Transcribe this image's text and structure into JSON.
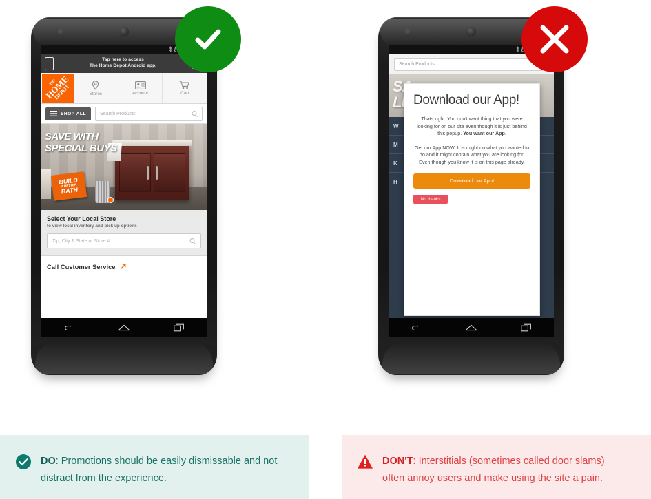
{
  "left": {
    "badge": {
      "icon": "check-circle-icon",
      "color": "#0f8c14"
    },
    "phone": {
      "status_bar": {
        "icons": [
          "bluetooth-icon",
          "nfc-icon",
          "wifi-icon",
          "signal-icon",
          "battery-icon"
        ]
      },
      "app_banner": {
        "icon": "mobile-phone-icon",
        "line1": "Tap here to access",
        "line2": "The Home Depot Android app.",
        "close_label": "✕"
      },
      "header": {
        "logo": {
          "the": "THE",
          "home": "HOME",
          "depot": "DEPOT"
        },
        "nav": [
          {
            "label": "Stores",
            "icon": "map-pin-icon"
          },
          {
            "label": "Account",
            "icon": "account-card-icon"
          },
          {
            "label": "Cart",
            "icon": "shopping-cart-icon"
          }
        ]
      },
      "search_row": {
        "shop_all_label": "SHOP ALL",
        "menu_icon": "hamburger-icon",
        "search_placeholder": "Search Products",
        "search_icon": "search-icon"
      },
      "hero": {
        "title_line1": "SAVE WITH",
        "title_line2": "SPECIAL BUYS",
        "badge_line1": "BUILD",
        "badge_line2": "A BETTER",
        "badge_line3": "BATH"
      },
      "local_store": {
        "title": "Select Your Local Store",
        "subtitle": "to view local inventory and pick up options",
        "input_placeholder": "Zip, City & State or Store #",
        "search_icon": "search-icon"
      },
      "call_row": {
        "label": "Call Customer Service",
        "icon": "external-link-arrow-icon"
      },
      "nav_bar": {
        "icons": [
          "back-icon",
          "home-icon",
          "recents-icon"
        ]
      }
    },
    "caption": {
      "icon": "check-circle-icon",
      "bold": "DO",
      "text": ": Promotions should be easily dismissable and not distract from the experience.",
      "bg": "#e2f1ee",
      "fg": "#1b7268"
    }
  },
  "right": {
    "badge": {
      "icon": "x-circle-icon",
      "color": "#d60a0a"
    },
    "phone": {
      "status_bar": {
        "icons": [
          "bluetooth-icon",
          "nfc-icon",
          "wifi-icon",
          "signal-icon",
          "battery-icon"
        ]
      },
      "search_bar": {
        "placeholder": "Search Products"
      },
      "background": {
        "hero_line1": "SA",
        "hero_line2": "LI",
        "list_rows": [
          "W",
          "M",
          "K",
          "H"
        ]
      },
      "popup": {
        "title": "Download our App!",
        "paragraph1_plain": "Thats right. You don't want thing that you were looking for on our site even though it is just behind this popup. ",
        "paragraph1_bold": "You want our App",
        "paragraph1_tail": ".",
        "paragraph2": "Get our App NOW. It is might do what you wanted to do and it might contain what you are looking for. Even though you know it is on this page already.",
        "cta_label": "Download our App!",
        "cta_color": "#ec8b0b",
        "dismiss_label": "No thanks",
        "dismiss_color": "#e8505c"
      },
      "nav_bar": {
        "icons": [
          "back-icon",
          "home-icon",
          "recents-icon"
        ]
      }
    },
    "caption": {
      "icon": "warning-triangle-icon",
      "bold": "DON'T",
      "text": ": Interstitials (sometimes called door slams) often annoy users and make using the site a pain.",
      "bg": "#fce9e9",
      "fg": "#e04343"
    }
  }
}
